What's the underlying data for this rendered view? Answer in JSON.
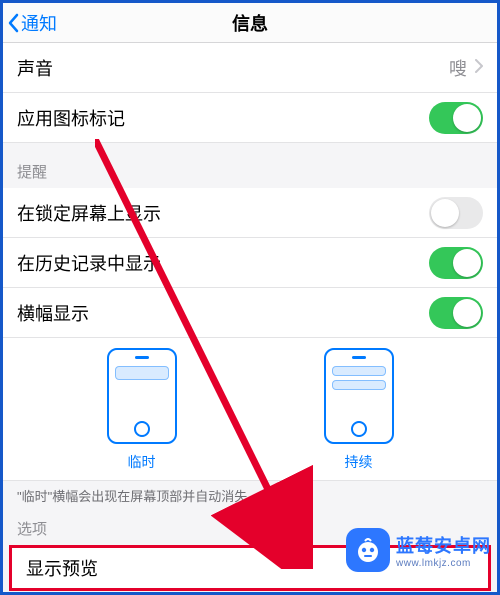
{
  "nav": {
    "back_label": "通知",
    "title": "信息"
  },
  "rows": {
    "sound": {
      "label": "声音",
      "value": "嗖"
    },
    "badge": {
      "label": "应用图标标记",
      "on": true
    }
  },
  "alerts": {
    "header": "提醒",
    "lock": {
      "label": "在锁定屏幕上显示",
      "on": false
    },
    "history": {
      "label": "在历史记录中显示",
      "on": true
    },
    "banner": {
      "label": "横幅显示",
      "on": true
    }
  },
  "banner_style": {
    "temporary": "临时",
    "persistent": "持续"
  },
  "footnote": "\"临时\"横幅会出现在屏幕顶部并自动消失。",
  "options": {
    "header": "选项",
    "preview": "显示预览"
  },
  "watermark": {
    "brand": "蓝莓安卓网",
    "url": "www.lmkjz.com"
  }
}
